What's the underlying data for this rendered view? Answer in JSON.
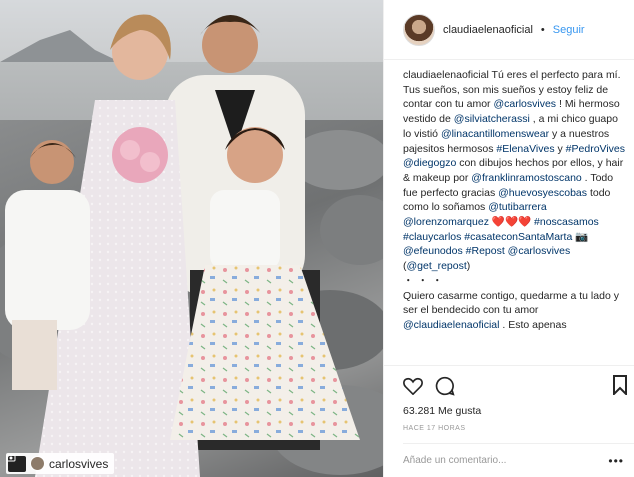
{
  "photo": {
    "repost_user": "carlosvives"
  },
  "header": {
    "username": "claudiaelenaoficial",
    "separator": "•",
    "follow_label": "Seguir"
  },
  "caption": {
    "author": "claudiaelenaoficial",
    "parts": [
      {
        "t": "Tú eres el perfecto para mí. Tus sueños, son mis sueños y estoy feliz de contar con tu amor ",
        "link": false
      },
      {
        "t": "@carlosvives",
        "link": true
      },
      {
        "t": " ! Mi hermoso vestido de ",
        "link": false
      },
      {
        "t": "@silviatcherassi",
        "link": true
      },
      {
        "t": " , a mi chico guapo lo vistió ",
        "link": false
      },
      {
        "t": "@linacantillomenswear",
        "link": true
      },
      {
        "t": " y a nuestros pajesitos hermosos ",
        "link": false
      },
      {
        "t": "#ElenaVives",
        "link": true
      },
      {
        "t": " y ",
        "link": false
      },
      {
        "t": "#PedroVives",
        "link": true
      },
      {
        "t": " ",
        "link": false
      },
      {
        "t": "@diegogzo",
        "link": true
      },
      {
        "t": " con dibujos hechos por ellos, y hair & makeup por ",
        "link": false
      },
      {
        "t": "@franklinramostoscano",
        "link": true
      },
      {
        "t": " . Todo fue perfecto gracias ",
        "link": false
      },
      {
        "t": "@huevosyescobas",
        "link": true
      },
      {
        "t": " todo como lo soñamos ",
        "link": false
      },
      {
        "t": "@tutibarrera",
        "link": true
      },
      {
        "t": " ",
        "link": false
      },
      {
        "t": "@lorenzomarquez",
        "link": true
      },
      {
        "t": " ❤️❤️❤️ ",
        "link": false
      },
      {
        "t": "#noscasamos",
        "link": true
      },
      {
        "t": " ",
        "link": false
      },
      {
        "t": "#clauycarlos",
        "link": true
      },
      {
        "t": " ",
        "link": false
      },
      {
        "t": "#casateconSantaMarta",
        "link": true
      },
      {
        "t": " 📷 ",
        "link": false
      },
      {
        "t": "@efeunodos",
        "link": true
      },
      {
        "t": " ",
        "link": false
      },
      {
        "t": "#Repost",
        "link": true
      },
      {
        "t": " ",
        "link": false
      },
      {
        "t": "@carlosvives",
        "link": true
      },
      {
        "t": " (",
        "link": false
      },
      {
        "t": "@get_repost",
        "link": true
      },
      {
        "t": ")",
        "link": false
      }
    ],
    "ellipsis": "・・・",
    "parts2": [
      {
        "t": "Quiero casarme contigo, quedarme a tu lado y ser el bendecido con tu amor ",
        "link": false
      },
      {
        "t": "@claudiaelenaoficial",
        "link": true
      },
      {
        "t": " . Esto apenas",
        "link": false
      }
    ]
  },
  "actions": {
    "like_icon": "heart-icon",
    "comment_icon": "comment-icon",
    "save_icon": "bookmark-icon"
  },
  "likes": "63.281 Me gusta",
  "time": "HACE 17 HORAS",
  "comment": {
    "placeholder": "Añade un comentario...",
    "more": "•••"
  }
}
